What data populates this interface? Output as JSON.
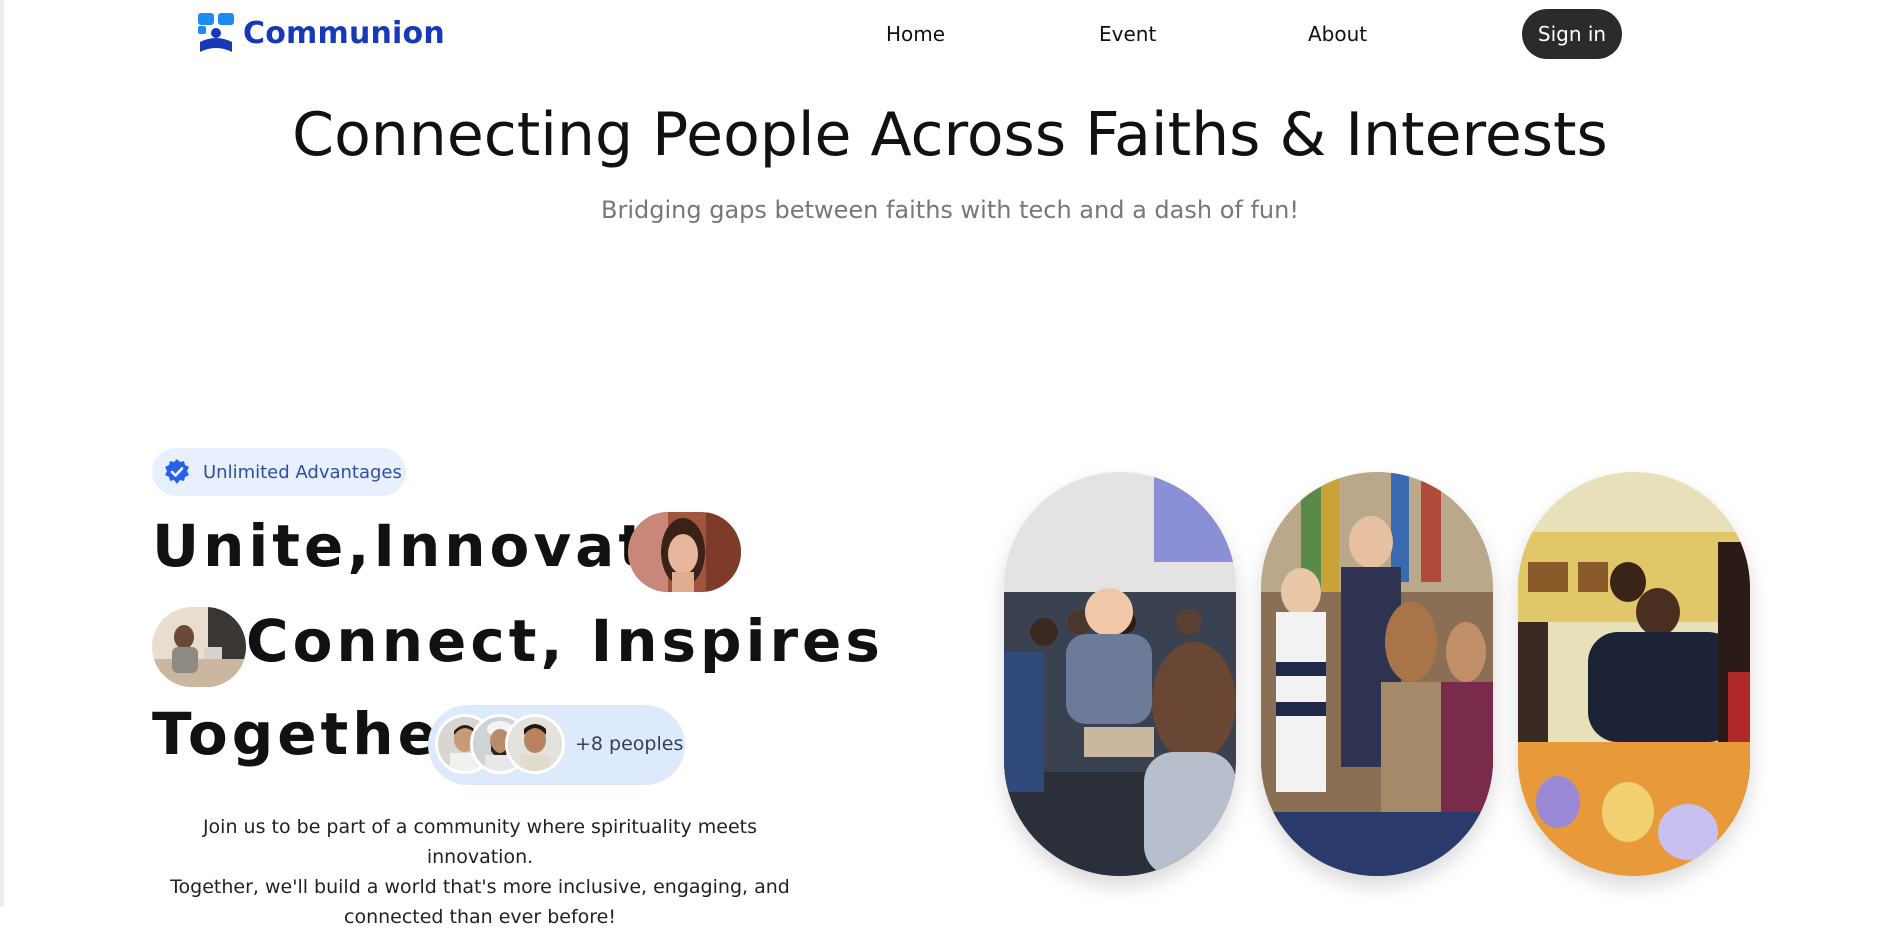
{
  "nav": {
    "brand": "Communion",
    "links": [
      "Home",
      "Event",
      "About"
    ],
    "signin": "Sign in"
  },
  "hero": {
    "title": "Connecting People Across Faiths & Interests",
    "subtitle": "Bridging gaps between faiths with tech and a dash of fun!"
  },
  "badge": {
    "icon": "verified-check-icon",
    "label": "Unlimited Advantages"
  },
  "headline": {
    "line1": "Unite,Innovate,",
    "line2": "Connect, Inspires",
    "line3": "Together"
  },
  "people": {
    "count_label": "+8 peoples"
  },
  "paragraph": [
    "Join us to be part of a community where spirituality meets innovation.",
    "Together, we'll build a world that's more inclusive, engaging, and",
    "connected than ever before!"
  ],
  "colors": {
    "brand": "#1739b8",
    "brand_accent": "#1e8bf0",
    "signin_bg": "#2b2b2b",
    "badge_bg": "#e8f0fd",
    "people_pill_bg": "#dceafc"
  }
}
